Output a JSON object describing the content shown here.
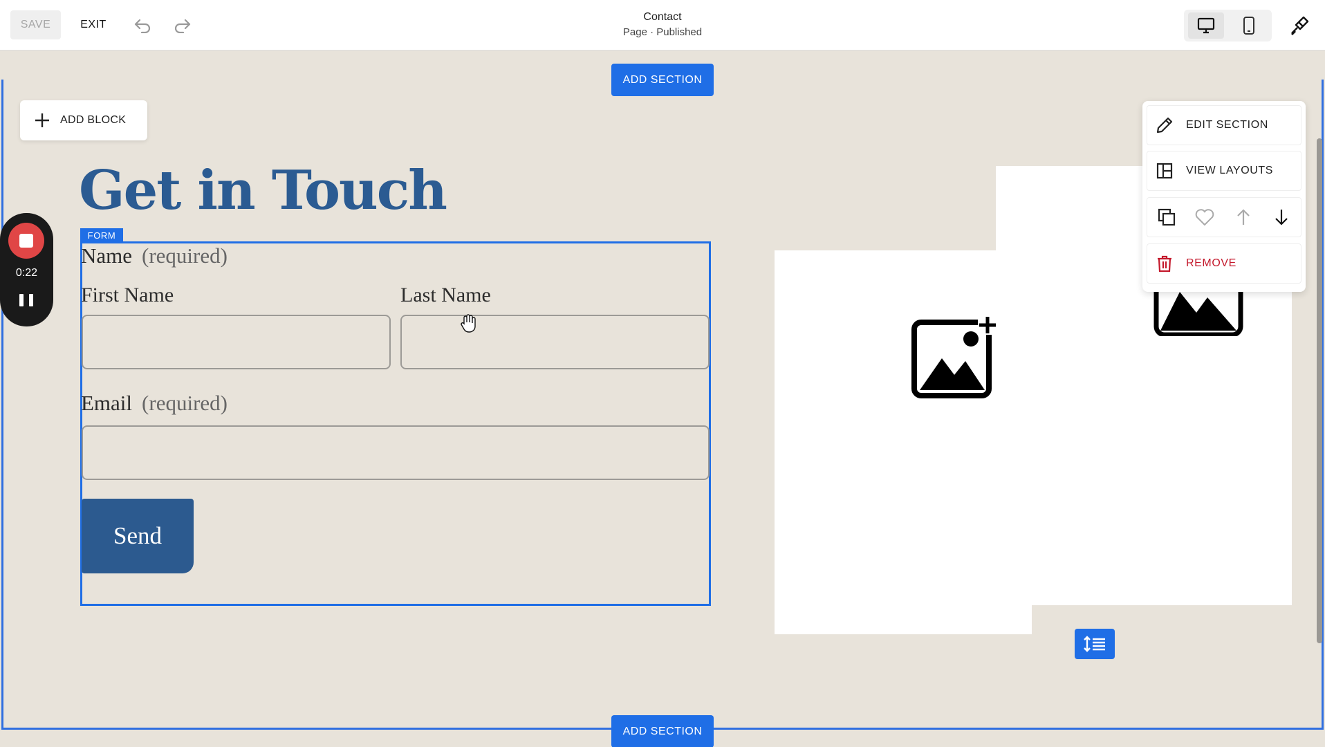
{
  "toolbar": {
    "save_label": "SAVE",
    "exit_label": "EXIT",
    "page_title": "Contact",
    "page_status": "Page · Published",
    "undo_icon": "undo-icon",
    "redo_icon": "redo-icon",
    "desktop_icon": "desktop-icon",
    "mobile_icon": "mobile-icon",
    "design_icon": "paintbrush-icon"
  },
  "section": {
    "add_section_top": "ADD SECTION",
    "add_section_bottom": "ADD SECTION",
    "add_block": "ADD BLOCK",
    "heading": "Get in Touch"
  },
  "recorder": {
    "time": "0:22"
  },
  "form": {
    "tag": "FORM",
    "name_label": "Name",
    "name_required": "(required)",
    "first_name_label": "First Name",
    "last_name_label": "Last Name",
    "email_label": "Email",
    "email_required": "(required)",
    "first_name_value": "",
    "last_name_value": "",
    "email_value": "",
    "send_label": "Send"
  },
  "section_menu": {
    "edit_section": "EDIT SECTION",
    "view_layouts": "VIEW LAYOUTS",
    "remove": "REMOVE",
    "actions": [
      "duplicate-icon",
      "heart-icon",
      "arrow-up-icon",
      "arrow-down-icon"
    ]
  },
  "colors": {
    "accent": "#1f6ee6",
    "heading": "#2b5b92",
    "button": "#2c5a8f",
    "canvas": "#e8e3da",
    "danger": "#c4192c"
  }
}
